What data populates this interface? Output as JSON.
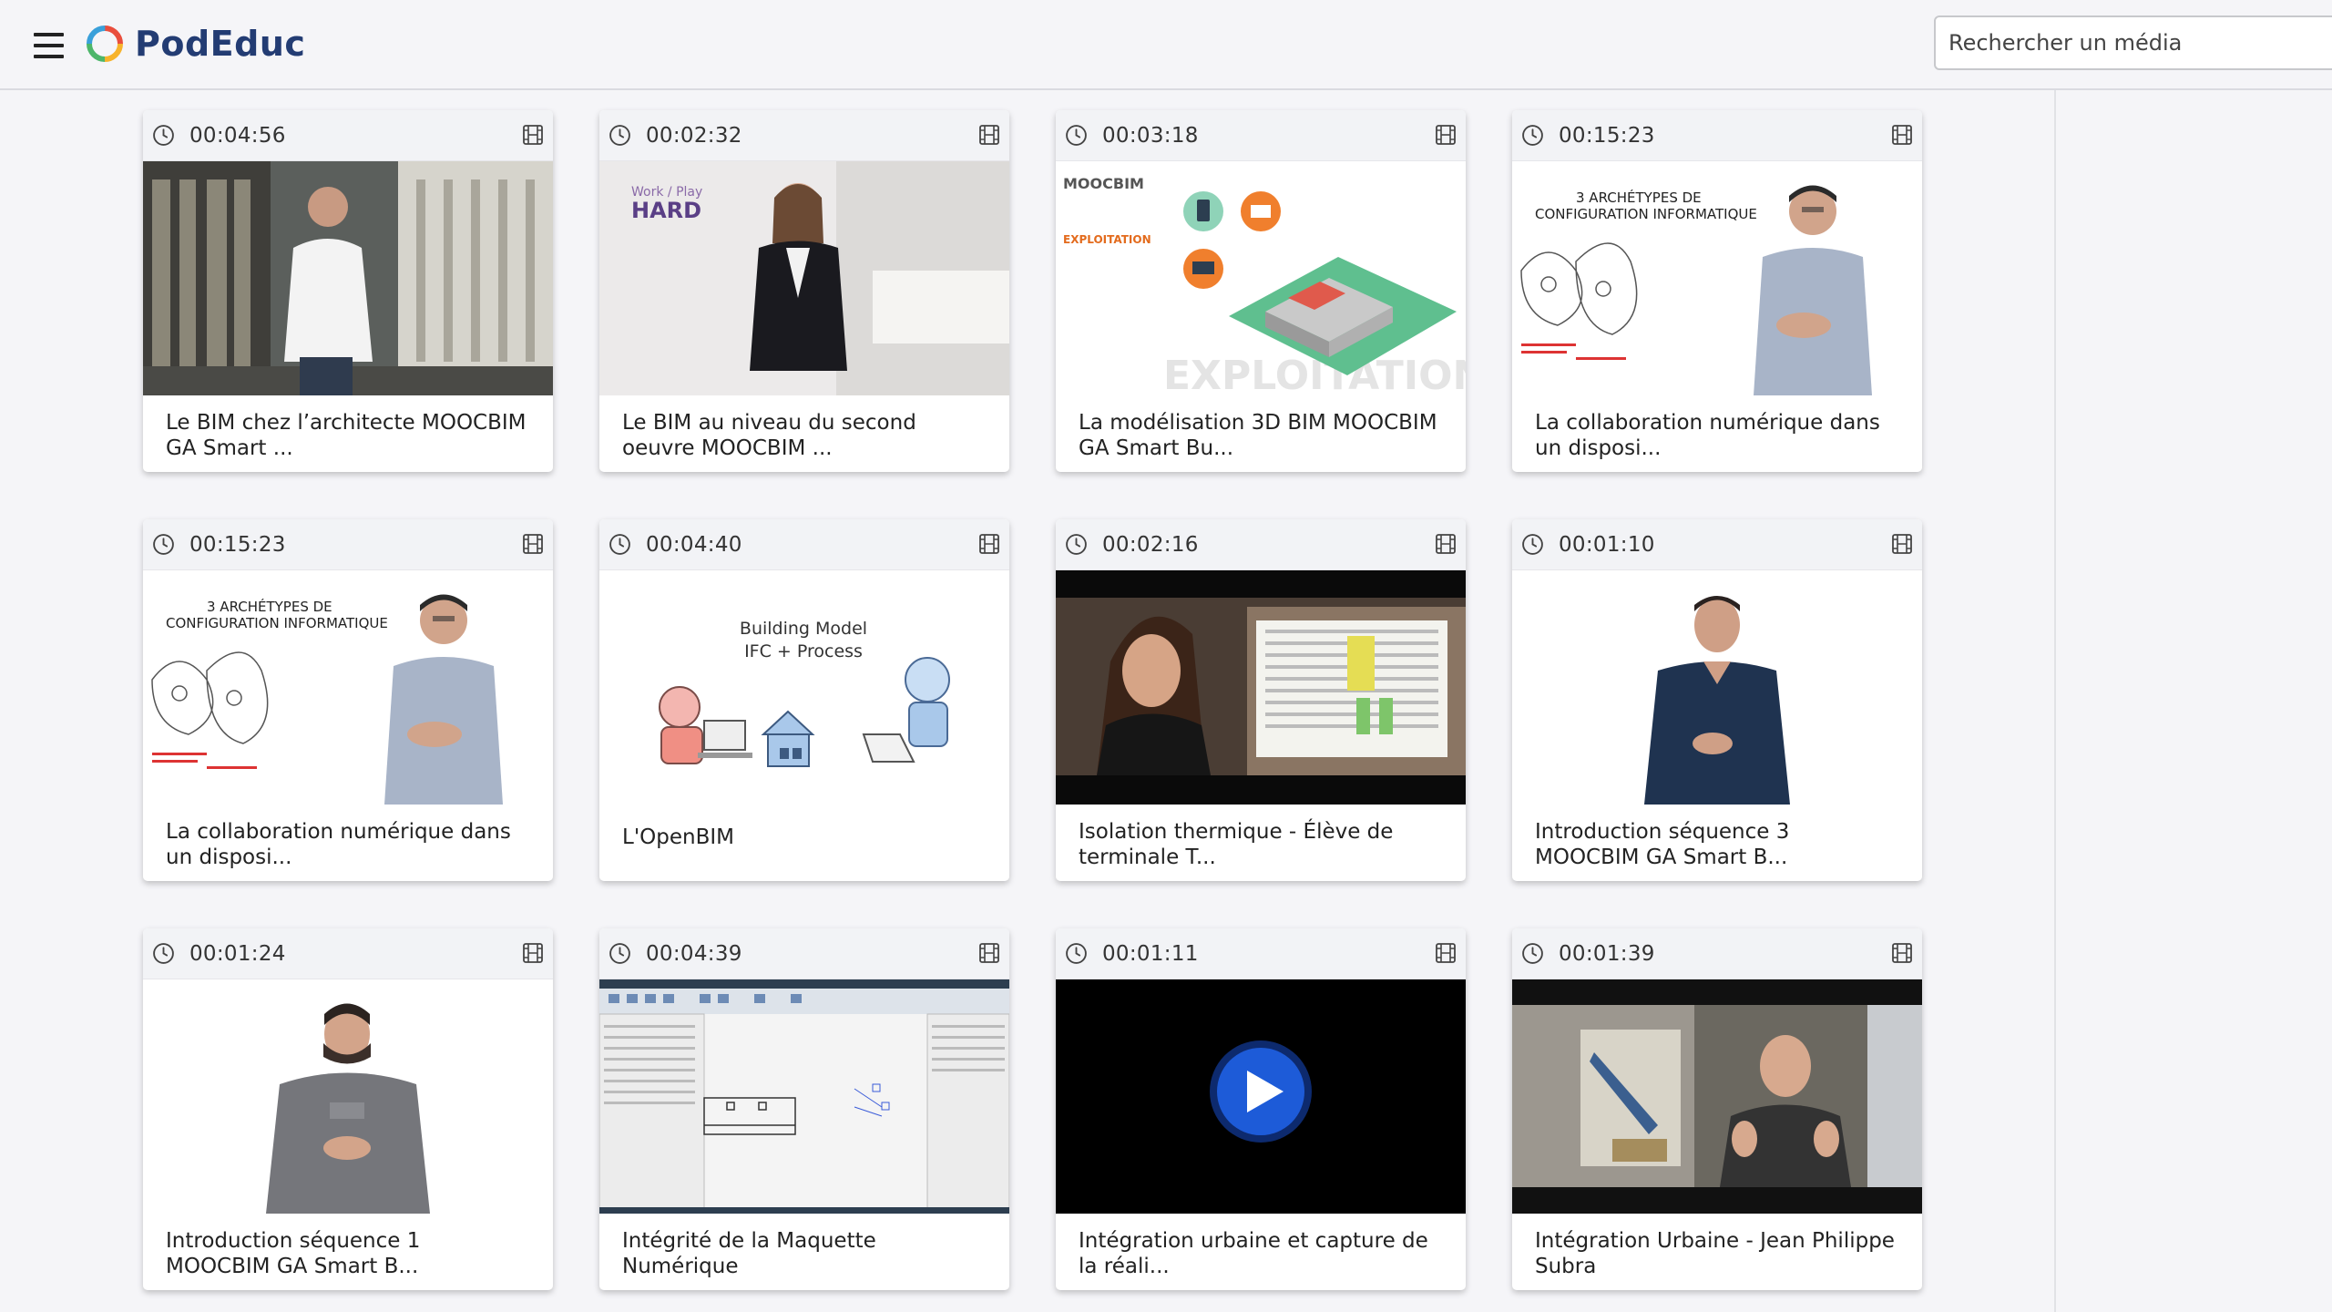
{
  "app": {
    "name": "PodEduc",
    "brand_color": "#233c73"
  },
  "header": {
    "menu_icon": "hamburger-icon",
    "search_placeholder": "Rechercher un média"
  },
  "videos": [
    {
      "duration": "00:04:56",
      "title": "Le BIM chez l’architecte MOOCBIM GA Smart ...",
      "thumb": "man-in-office-library"
    },
    {
      "duration": "00:02:32",
      "title": "Le BIM au niveau du second oeuvre MOOCBIM ...",
      "thumb": "woman-in-office-hard-work"
    },
    {
      "duration": "00:03:18",
      "title": "La modélisation 3D BIM MOOCBIM GA Smart Bu...",
      "thumb": "isometric-building-exploitation"
    },
    {
      "duration": "00:15:23",
      "title": "La collaboration numérique dans un disposi...",
      "thumb": "presenter-with-sketch"
    },
    {
      "duration": "00:15:23",
      "title": "La collaboration numérique dans un disposi...",
      "thumb": "presenter-with-sketch"
    },
    {
      "duration": "00:04:40",
      "title": "L'OpenBIM",
      "thumb": "building-model-illustration"
    },
    {
      "duration": "00:02:16",
      "title": "Isolation thermique - Élève de terminale T...",
      "thumb": "student-with-spreadsheet"
    },
    {
      "duration": "00:01:10",
      "title": "Introduction séquence 3 MOOCBIM GA Smart B...",
      "thumb": "man-on-white-background"
    },
    {
      "duration": "00:01:24",
      "title": "Introduction séquence 1 MOOCBIM GA Smart B...",
      "thumb": "man-in-hoodie"
    },
    {
      "duration": "00:04:39",
      "title": "Intégrité de la Maquette Numérique",
      "thumb": "cad-software-screenshot"
    },
    {
      "duration": "00:01:11",
      "title": "Intégration urbaine et capture de la réali...",
      "thumb": "play-button-black"
    },
    {
      "duration": "00:01:39",
      "title": "Intégration Urbaine - Jean Philippe Subra",
      "thumb": "man-speaking-with-photo"
    }
  ],
  "embedded_thumbnail_text": {
    "hard_work": [
      "Work / Play",
      "HARD"
    ],
    "moocbim_panel": [
      "MOOCBIM",
      "EXPLOITATION"
    ],
    "archetypes": [
      "3 ARCHÉTYPES DE",
      "CONFIGURATION INFORMATIQUE"
    ],
    "building_model": [
      "Building Model",
      "IFC + Process"
    ]
  }
}
